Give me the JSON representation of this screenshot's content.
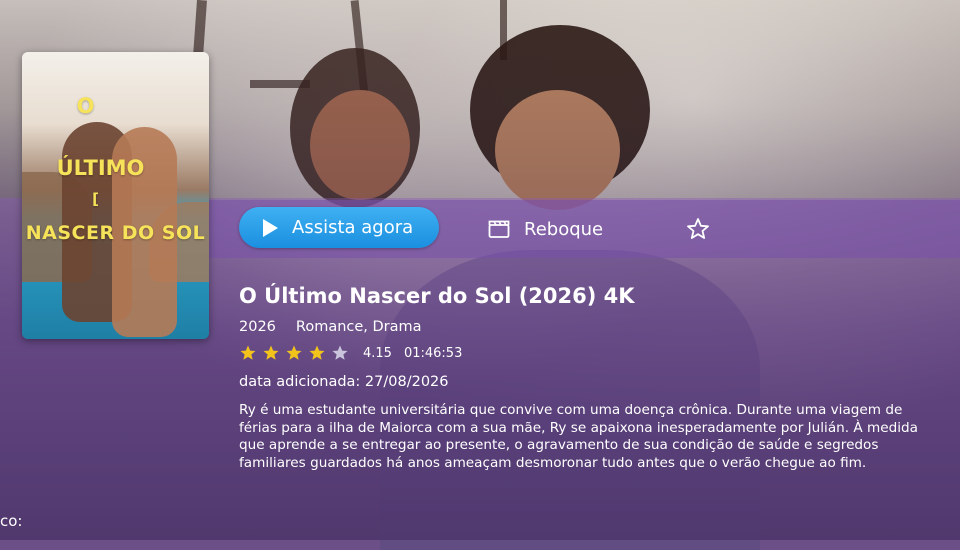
{
  "poster": {
    "title_lines": [
      "O",
      "ÚLTIMO",
      "[",
      "NASCER DO SOL"
    ]
  },
  "actions": {
    "watch_label": "Assista agora",
    "trailer_label": "Reboque",
    "play_icon": "play-icon",
    "trailer_icon": "clapperboard-icon",
    "favorite_icon": "star-outline-icon"
  },
  "movie": {
    "title": "O Último Nascer do Sol (2026) 4K",
    "year": "2026",
    "genres": "Romance, Drama",
    "rating_value": 4.15,
    "rating_text": "4.15",
    "stars_filled": 4,
    "stars_total": 5,
    "duration": "01:46:53",
    "added_label": "data adicionada:",
    "added_date": "27/08/2026",
    "synopsis": "Ry é uma estudante universitária que convive com uma doença crônica. Durante uma viagem de férias para a ilha de Maiorca com a sua mãe, Ry se apaixona inesperadamente por Julián. À medida que aprende a se entregar ao presente, o agravamento de sua condição de saúde e segredos familiares guardados há anos ameaçam desmoronar tudo antes que o verão chegue ao fim."
  },
  "footer": {
    "partial_label": "co:"
  },
  "colors": {
    "accent_blue": "#1b8fe0",
    "star_gold": "#f2c31b",
    "overlay_purple": "#6e4696",
    "poster_title_yellow": "#f6e35a"
  }
}
